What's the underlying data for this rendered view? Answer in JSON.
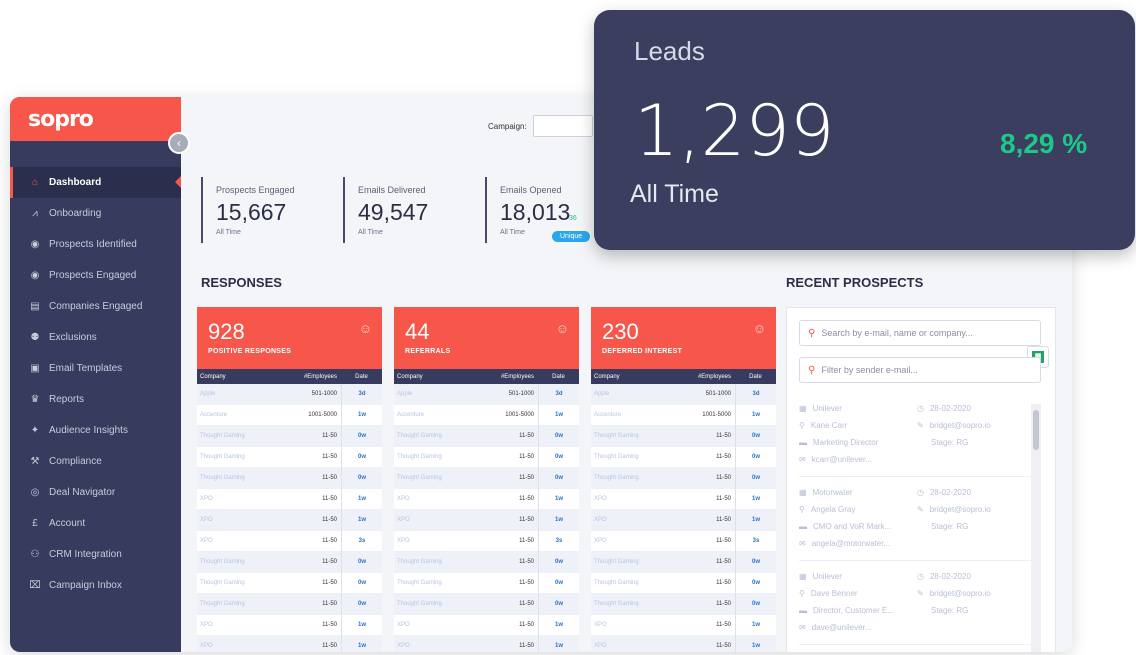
{
  "brand": {
    "logo": "sopro"
  },
  "campaign": {
    "label": "Campaign:"
  },
  "sidebar": {
    "items": [
      {
        "label": "Dashboard",
        "icon": "home-icon",
        "glyph": "⌂",
        "active": true
      },
      {
        "label": "Onboarding",
        "icon": "chart-line-icon",
        "glyph": "⩘"
      },
      {
        "label": "Prospects Identified",
        "icon": "target-icon",
        "glyph": "◉"
      },
      {
        "label": "Prospects Engaged",
        "icon": "target-icon",
        "glyph": "◉"
      },
      {
        "label": "Companies Engaged",
        "icon": "building-icon",
        "glyph": "▤"
      },
      {
        "label": "Exclusions",
        "icon": "user-block-icon",
        "glyph": "⚉"
      },
      {
        "label": "Email Templates",
        "icon": "template-icon",
        "glyph": "▣"
      },
      {
        "label": "Reports",
        "icon": "trophy-icon",
        "glyph": "♛"
      },
      {
        "label": "Audience Insights",
        "icon": "puzzle-icon",
        "glyph": "✦"
      },
      {
        "label": "Compliance",
        "icon": "gavel-icon",
        "glyph": "⚒"
      },
      {
        "label": "Deal Navigator",
        "icon": "compass-icon",
        "glyph": "◎"
      },
      {
        "label": "Account",
        "icon": "pound-icon",
        "glyph": "£"
      },
      {
        "label": "CRM Integration",
        "icon": "crm-icon",
        "glyph": "⚇"
      },
      {
        "label": "Campaign Inbox",
        "icon": "inbox-icon",
        "glyph": "⌧"
      }
    ]
  },
  "stats": [
    {
      "label": "Prospects Engaged",
      "value": "15,667",
      "sub": "All Time"
    },
    {
      "label": "Emails Delivered",
      "value": "49,547",
      "sub": "All Time"
    },
    {
      "label": "Emails Opened",
      "value": "18,013",
      "sub": "All Time",
      "mini": "36",
      "pill": "Unique"
    }
  ],
  "responses": {
    "title": "RESPONSES",
    "columns": [
      "Company",
      "#Employees",
      "Date"
    ],
    "cards": [
      {
        "value": "928",
        "label": "POSITIVE RESPONSES",
        "rows": [
          [
            "Apple",
            "501-1000",
            "3d"
          ],
          [
            "Accenture",
            "1001-5000",
            "1w"
          ],
          [
            "Thought Gaming",
            "11-50",
            "0w"
          ],
          [
            "Thought Gaming",
            "11-50",
            "0w"
          ],
          [
            "Thought Gaming",
            "11-50",
            "0w"
          ],
          [
            "XPO",
            "11-50",
            "1w"
          ],
          [
            "XPO",
            "11-50",
            "1w"
          ],
          [
            "XPO",
            "11-50",
            "3s"
          ],
          [
            "Thought Gaming",
            "11-50",
            "0w"
          ],
          [
            "Thought Gaming",
            "11-50",
            "0w"
          ],
          [
            "Thought Gaming",
            "11-50",
            "0w"
          ],
          [
            "XPO",
            "11-50",
            "1w"
          ],
          [
            "XPO",
            "11-50",
            "1w"
          ]
        ]
      },
      {
        "value": "44",
        "label": "REFERRALS",
        "rows": [
          [
            "Apple",
            "501-1000",
            "3d"
          ],
          [
            "Accenture",
            "1001-5000",
            "1w"
          ],
          [
            "Thought Gaming",
            "11-50",
            "0w"
          ],
          [
            "Thought Gaming",
            "11-50",
            "0w"
          ],
          [
            "Thought Gaming",
            "11-50",
            "0w"
          ],
          [
            "XPO",
            "11-50",
            "1w"
          ],
          [
            "XPO",
            "11-50",
            "1w"
          ],
          [
            "XPO",
            "11-50",
            "3s"
          ],
          [
            "Thought Gaming",
            "11-50",
            "0w"
          ],
          [
            "Thought Gaming",
            "11-50",
            "0w"
          ],
          [
            "Thought Gaming",
            "11-50",
            "0w"
          ],
          [
            "XPO",
            "11-50",
            "1w"
          ],
          [
            "XPO",
            "11-50",
            "1w"
          ]
        ]
      },
      {
        "value": "230",
        "label": "DEFERRED INTEREST",
        "rows": [
          [
            "Apple",
            "501-1000",
            "3d"
          ],
          [
            "Accenture",
            "1001-5000",
            "1w"
          ],
          [
            "Thought Gaming",
            "11-50",
            "0w"
          ],
          [
            "Thought Gaming",
            "11-50",
            "0w"
          ],
          [
            "Thought Gaming",
            "11-50",
            "0w"
          ],
          [
            "XPO",
            "11-50",
            "1w"
          ],
          [
            "XPO",
            "11-50",
            "1w"
          ],
          [
            "XPO",
            "11-50",
            "3s"
          ],
          [
            "Thought Gaming",
            "11-50",
            "0w"
          ],
          [
            "Thought Gaming",
            "11-50",
            "0w"
          ],
          [
            "Thought Gaming",
            "11-50",
            "0w"
          ],
          [
            "XPO",
            "11-50",
            "1w"
          ],
          [
            "XPO",
            "11-50",
            "1w"
          ]
        ]
      }
    ]
  },
  "recent": {
    "title": "RECENT PROSPECTS",
    "search_placeholder": "Search by e-mail, name or company...",
    "filter_placeholder": "Filter by sender e-mail...",
    "prospects": [
      {
        "company": "Unilever",
        "name": "Kane Carr",
        "role": "Marketing Director",
        "email": "kcarr@unilever...",
        "date": "28-02-2020",
        "sender": "bridget@sopro.io",
        "stage": "Stage: RG"
      },
      {
        "company": "Motorwater",
        "name": "Angela Gray",
        "role": "CMO and VoR Mark...",
        "email": "angela@motorwater...",
        "date": "28-02-2020",
        "sender": "bridget@sopro.io",
        "stage": "Stage: RG"
      },
      {
        "company": "Unilever",
        "name": "Dave Benner",
        "role": "Director, Customer E...",
        "email": "dave@unilever...",
        "date": "28-02-2020",
        "sender": "bridget@sopro.io",
        "stage": "Stage: RG"
      }
    ]
  },
  "leads": {
    "title": "Leads",
    "value": "1,299",
    "period": "All Time",
    "change": "8,29 %"
  }
}
